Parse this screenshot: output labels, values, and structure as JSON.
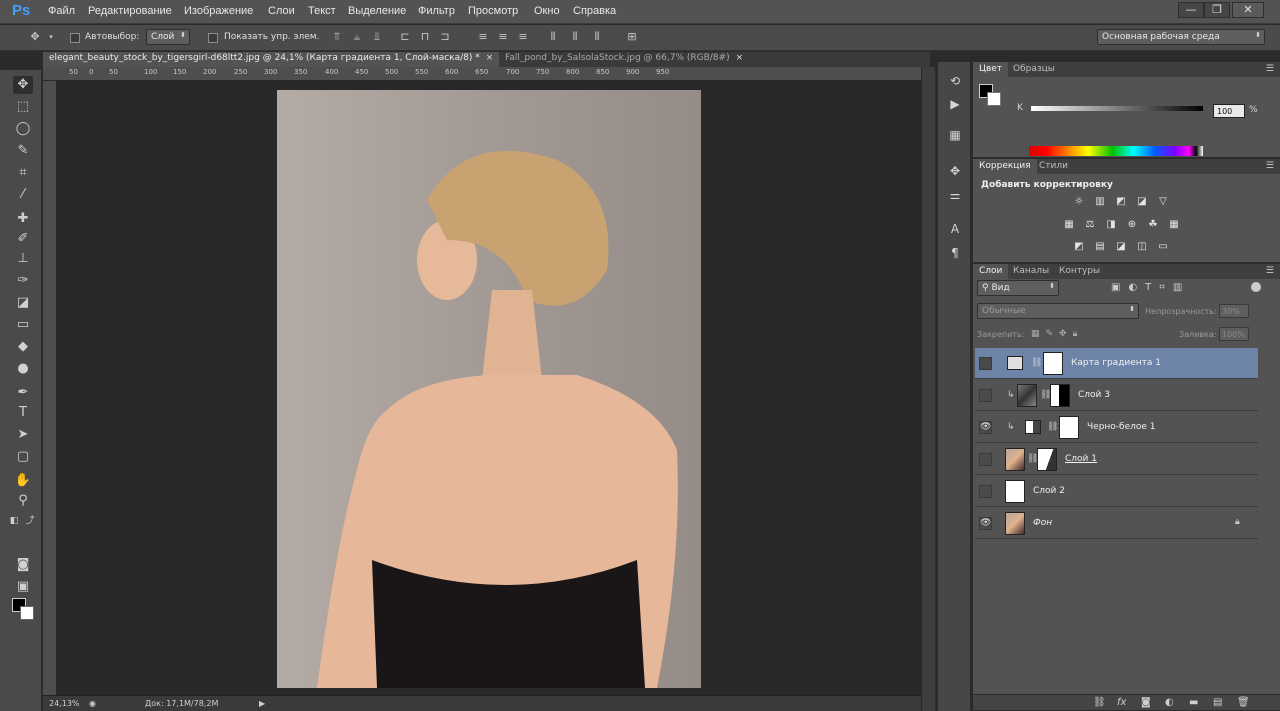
{
  "app": {
    "logo": "Ps"
  },
  "menu": [
    "Файл",
    "Редактирование",
    "Изображение",
    "Слои",
    "Текст",
    "Выделение",
    "Фильтр",
    "Просмотр",
    "Окно",
    "Справка"
  ],
  "window_controls": {
    "minimize": "—",
    "restore": "❐",
    "close": "✕"
  },
  "options_bar": {
    "autoselect_label": "Автовыбор:",
    "autoselect_value": "Слой",
    "show_controls_label": "Показать упр. элем.",
    "workspace": "Основная рабочая среда"
  },
  "tabs": [
    {
      "title": "elegant_beauty_stock_by_tigersgirl-d68ltt2.jpg @ 24,1% (Карта градиента 1, Слой-маска/8) *",
      "close": "×"
    },
    {
      "title": "Fall_pond_by_SalsolaStock.jpg @ 66,7% (RGB/8#)",
      "close": "×"
    }
  ],
  "ruler_ticks": [
    "50",
    "0",
    "50",
    "100",
    "150",
    "200",
    "250",
    "300",
    "350",
    "400",
    "450",
    "500",
    "550",
    "600",
    "650",
    "700",
    "750",
    "800",
    "850",
    "900",
    "950"
  ],
  "status": {
    "zoom": "24,13%",
    "doc": "Док: 17,1M/78,2M"
  },
  "color_panel": {
    "tabs": [
      "Цвет",
      "Образцы"
    ],
    "channel_label": "K",
    "value": "100",
    "unit": "%"
  },
  "adjustments_panel": {
    "tabs": [
      "Коррекция",
      "Стили"
    ],
    "heading": "Добавить корректировку",
    "icons": [
      "brightness-icon",
      "levels-icon",
      "curves-icon",
      "exposure-icon",
      "vibrance-icon",
      "hue-saturation-icon",
      "color-balance-icon",
      "black-white-icon",
      "photo-filter-icon",
      "channel-mixer-icon",
      "color-lookup-icon",
      "invert-icon",
      "posterize-icon",
      "threshold-icon",
      "selective-color-icon",
      "gradient-map-icon"
    ]
  },
  "layers_panel": {
    "tabs": [
      "Слои",
      "Каналы",
      "Контуры"
    ],
    "filter_label": "Вид",
    "blend_mode": "Обычные",
    "opacity_label": "Непрозрачность:",
    "opacity_value": "30%",
    "lock_label": "Закрепить:",
    "fill_label": "Заливка:",
    "fill_value": "100%",
    "layers": [
      {
        "name": "Карта градиента 1",
        "selected": true,
        "visible": false,
        "clipped": false
      },
      {
        "name": "Слой 3",
        "selected": false,
        "visible": false,
        "clipped": true
      },
      {
        "name": "Черно-белое 1",
        "selected": false,
        "visible": true,
        "clipped": true
      },
      {
        "name": "Слой 1",
        "selected": false,
        "visible": false,
        "clipped": false
      },
      {
        "name": "Слой 2",
        "selected": false,
        "visible": false,
        "clipped": false
      },
      {
        "name": "Фон",
        "selected": false,
        "visible": true,
        "clipped": false,
        "locked": true
      }
    ],
    "footer_icons": [
      "link-icon",
      "fx-icon",
      "mask-icon",
      "adjustment-icon",
      "group-icon",
      "new-layer-icon",
      "trash-icon"
    ]
  }
}
